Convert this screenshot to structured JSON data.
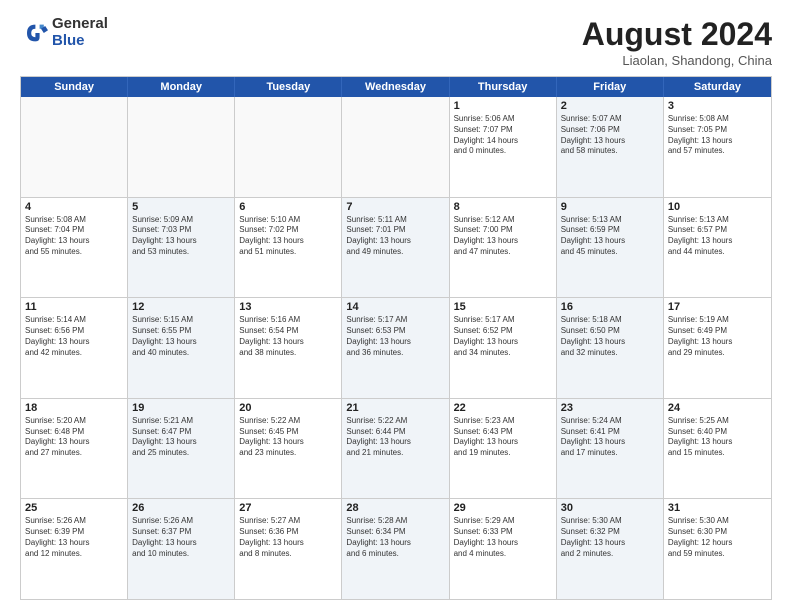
{
  "logo": {
    "general": "General",
    "blue": "Blue"
  },
  "title": "August 2024",
  "subtitle": "Liaolan, Shandong, China",
  "days": [
    "Sunday",
    "Monday",
    "Tuesday",
    "Wednesday",
    "Thursday",
    "Friday",
    "Saturday"
  ],
  "weeks": [
    [
      {
        "day": "",
        "text": "",
        "shade": false,
        "empty": true
      },
      {
        "day": "",
        "text": "",
        "shade": false,
        "empty": true
      },
      {
        "day": "",
        "text": "",
        "shade": false,
        "empty": true
      },
      {
        "day": "",
        "text": "",
        "shade": false,
        "empty": true
      },
      {
        "day": "1",
        "text": "Sunrise: 5:06 AM\nSunset: 7:07 PM\nDaylight: 14 hours\nand 0 minutes.",
        "shade": false,
        "empty": false
      },
      {
        "day": "2",
        "text": "Sunrise: 5:07 AM\nSunset: 7:06 PM\nDaylight: 13 hours\nand 58 minutes.",
        "shade": true,
        "empty": false
      },
      {
        "day": "3",
        "text": "Sunrise: 5:08 AM\nSunset: 7:05 PM\nDaylight: 13 hours\nand 57 minutes.",
        "shade": false,
        "empty": false
      }
    ],
    [
      {
        "day": "4",
        "text": "Sunrise: 5:08 AM\nSunset: 7:04 PM\nDaylight: 13 hours\nand 55 minutes.",
        "shade": false,
        "empty": false
      },
      {
        "day": "5",
        "text": "Sunrise: 5:09 AM\nSunset: 7:03 PM\nDaylight: 13 hours\nand 53 minutes.",
        "shade": true,
        "empty": false
      },
      {
        "day": "6",
        "text": "Sunrise: 5:10 AM\nSunset: 7:02 PM\nDaylight: 13 hours\nand 51 minutes.",
        "shade": false,
        "empty": false
      },
      {
        "day": "7",
        "text": "Sunrise: 5:11 AM\nSunset: 7:01 PM\nDaylight: 13 hours\nand 49 minutes.",
        "shade": true,
        "empty": false
      },
      {
        "day": "8",
        "text": "Sunrise: 5:12 AM\nSunset: 7:00 PM\nDaylight: 13 hours\nand 47 minutes.",
        "shade": false,
        "empty": false
      },
      {
        "day": "9",
        "text": "Sunrise: 5:13 AM\nSunset: 6:59 PM\nDaylight: 13 hours\nand 45 minutes.",
        "shade": true,
        "empty": false
      },
      {
        "day": "10",
        "text": "Sunrise: 5:13 AM\nSunset: 6:57 PM\nDaylight: 13 hours\nand 44 minutes.",
        "shade": false,
        "empty": false
      }
    ],
    [
      {
        "day": "11",
        "text": "Sunrise: 5:14 AM\nSunset: 6:56 PM\nDaylight: 13 hours\nand 42 minutes.",
        "shade": false,
        "empty": false
      },
      {
        "day": "12",
        "text": "Sunrise: 5:15 AM\nSunset: 6:55 PM\nDaylight: 13 hours\nand 40 minutes.",
        "shade": true,
        "empty": false
      },
      {
        "day": "13",
        "text": "Sunrise: 5:16 AM\nSunset: 6:54 PM\nDaylight: 13 hours\nand 38 minutes.",
        "shade": false,
        "empty": false
      },
      {
        "day": "14",
        "text": "Sunrise: 5:17 AM\nSunset: 6:53 PM\nDaylight: 13 hours\nand 36 minutes.",
        "shade": true,
        "empty": false
      },
      {
        "day": "15",
        "text": "Sunrise: 5:17 AM\nSunset: 6:52 PM\nDaylight: 13 hours\nand 34 minutes.",
        "shade": false,
        "empty": false
      },
      {
        "day": "16",
        "text": "Sunrise: 5:18 AM\nSunset: 6:50 PM\nDaylight: 13 hours\nand 32 minutes.",
        "shade": true,
        "empty": false
      },
      {
        "day": "17",
        "text": "Sunrise: 5:19 AM\nSunset: 6:49 PM\nDaylight: 13 hours\nand 29 minutes.",
        "shade": false,
        "empty": false
      }
    ],
    [
      {
        "day": "18",
        "text": "Sunrise: 5:20 AM\nSunset: 6:48 PM\nDaylight: 13 hours\nand 27 minutes.",
        "shade": false,
        "empty": false
      },
      {
        "day": "19",
        "text": "Sunrise: 5:21 AM\nSunset: 6:47 PM\nDaylight: 13 hours\nand 25 minutes.",
        "shade": true,
        "empty": false
      },
      {
        "day": "20",
        "text": "Sunrise: 5:22 AM\nSunset: 6:45 PM\nDaylight: 13 hours\nand 23 minutes.",
        "shade": false,
        "empty": false
      },
      {
        "day": "21",
        "text": "Sunrise: 5:22 AM\nSunset: 6:44 PM\nDaylight: 13 hours\nand 21 minutes.",
        "shade": true,
        "empty": false
      },
      {
        "day": "22",
        "text": "Sunrise: 5:23 AM\nSunset: 6:43 PM\nDaylight: 13 hours\nand 19 minutes.",
        "shade": false,
        "empty": false
      },
      {
        "day": "23",
        "text": "Sunrise: 5:24 AM\nSunset: 6:41 PM\nDaylight: 13 hours\nand 17 minutes.",
        "shade": true,
        "empty": false
      },
      {
        "day": "24",
        "text": "Sunrise: 5:25 AM\nSunset: 6:40 PM\nDaylight: 13 hours\nand 15 minutes.",
        "shade": false,
        "empty": false
      }
    ],
    [
      {
        "day": "25",
        "text": "Sunrise: 5:26 AM\nSunset: 6:39 PM\nDaylight: 13 hours\nand 12 minutes.",
        "shade": false,
        "empty": false
      },
      {
        "day": "26",
        "text": "Sunrise: 5:26 AM\nSunset: 6:37 PM\nDaylight: 13 hours\nand 10 minutes.",
        "shade": true,
        "empty": false
      },
      {
        "day": "27",
        "text": "Sunrise: 5:27 AM\nSunset: 6:36 PM\nDaylight: 13 hours\nand 8 minutes.",
        "shade": false,
        "empty": false
      },
      {
        "day": "28",
        "text": "Sunrise: 5:28 AM\nSunset: 6:34 PM\nDaylight: 13 hours\nand 6 minutes.",
        "shade": true,
        "empty": false
      },
      {
        "day": "29",
        "text": "Sunrise: 5:29 AM\nSunset: 6:33 PM\nDaylight: 13 hours\nand 4 minutes.",
        "shade": false,
        "empty": false
      },
      {
        "day": "30",
        "text": "Sunrise: 5:30 AM\nSunset: 6:32 PM\nDaylight: 13 hours\nand 2 minutes.",
        "shade": true,
        "empty": false
      },
      {
        "day": "31",
        "text": "Sunrise: 5:30 AM\nSunset: 6:30 PM\nDaylight: 12 hours\nand 59 minutes.",
        "shade": false,
        "empty": false
      }
    ]
  ]
}
